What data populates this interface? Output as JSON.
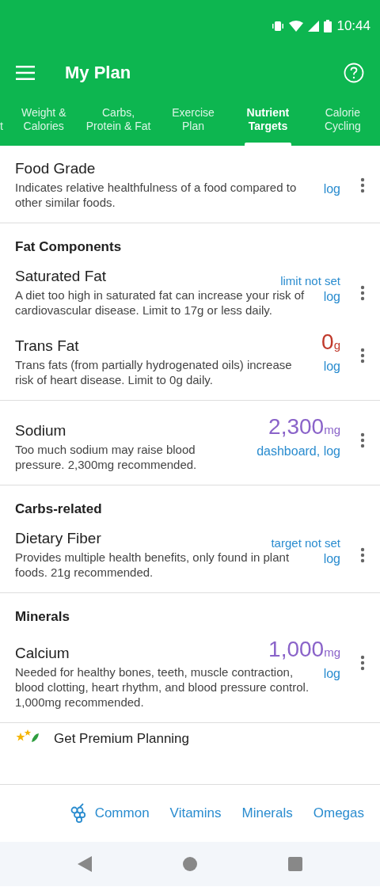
{
  "status_bar": {
    "time": "10:44"
  },
  "app_bar": {
    "title": "My Plan"
  },
  "tabs": [
    {
      "label": "t",
      "selected": false
    },
    {
      "label": "Weight &\nCalories",
      "selected": false
    },
    {
      "label": "Carbs,\nProtein & Fat",
      "selected": false
    },
    {
      "label": "Exercise\nPlan",
      "selected": false
    },
    {
      "label": "Nutrient\nTargets",
      "selected": true
    },
    {
      "label": "Calorie\nCycling",
      "selected": false
    }
  ],
  "sections": [
    {
      "items": [
        {
          "name": "Food Grade",
          "description": "Indicates relative healthfulness of a food compared to other similar foods.",
          "action": "log"
        }
      ]
    },
    {
      "heading": "Fat Components",
      "items": [
        {
          "name": "Saturated Fat",
          "description": "A diet too high in saturated fat can increase your risk of cardiovascular disease. Limit to 17g or less daily.",
          "status": "limit not set",
          "action": "log"
        },
        {
          "name": "Trans Fat",
          "description": "Trans fats (from partially hydrogenated oils) increase risk of heart disease. Limit to 0g daily.",
          "value": "0",
          "unit": "g",
          "color": "#c0392b",
          "action": "log"
        }
      ]
    },
    {
      "items": [
        {
          "name": "Sodium",
          "description": "Too much sodium may raise blood pressure. 2,300mg recommended.",
          "value": "2,300",
          "unit": "mg",
          "color": "#8a63c9",
          "action": "dashboard, log"
        }
      ]
    },
    {
      "heading": "Carbs-related",
      "items": [
        {
          "name": "Dietary Fiber",
          "description": "Provides multiple health benefits, only found in plant foods. 21g recommended.",
          "status": "target not set",
          "action": "log"
        }
      ]
    },
    {
      "heading": "Minerals",
      "items": [
        {
          "name": "Calcium",
          "description": "Needed for healthy bones, teeth, muscle contraction, blood clotting, heart rhythm, and blood pressure control. 1,000mg recommended.",
          "value": "1,000",
          "unit": "mg",
          "color": "#8a63c9",
          "action": "log"
        }
      ]
    }
  ],
  "premium": {
    "label": "Get Premium Planning"
  },
  "bottom_tabs": [
    {
      "label": "Common",
      "icon": true
    },
    {
      "label": "Vitamins",
      "icon": false
    },
    {
      "label": "Minerals",
      "icon": false
    },
    {
      "label": "Omegas",
      "icon": false
    }
  ]
}
